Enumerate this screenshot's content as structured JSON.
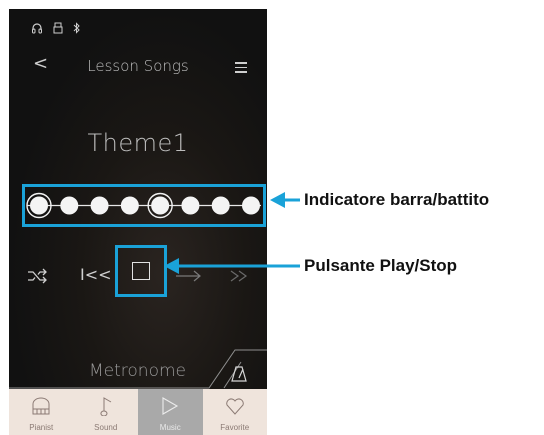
{
  "status_icons": [
    "headphones-icon",
    "usb-icon",
    "bluetooth-icon"
  ],
  "header": {
    "back_glyph": "<",
    "title": "Lesson Songs",
    "menu_icon": "list-icon"
  },
  "song": {
    "name": "Theme1"
  },
  "beat_indicator": {
    "dots": 8,
    "accent_positions": [
      1,
      5
    ]
  },
  "controls": {
    "shuffle_icon": "shuffle-icon",
    "rewind_glyph": "I<<",
    "stop_icon": "stop-icon"
  },
  "metronome": {
    "label": "Metronome",
    "icon": "metronome-icon"
  },
  "tabs": [
    {
      "label": "Pianist",
      "icon": "piano-icon",
      "active": false
    },
    {
      "label": "Sound",
      "icon": "note-icon",
      "active": false
    },
    {
      "label": "Music",
      "icon": "play-icon",
      "active": true
    },
    {
      "label": "Favorite",
      "icon": "heart-icon",
      "active": false
    }
  ],
  "callouts": {
    "beat_indicator": "Indicatore barra/battito",
    "play_stop": "Pulsante Play/Stop"
  },
  "colors": {
    "highlight": "#1aa2d8",
    "tabbar_bg": "#efe4dc",
    "tab_active_bg": "#a9a9a9"
  }
}
